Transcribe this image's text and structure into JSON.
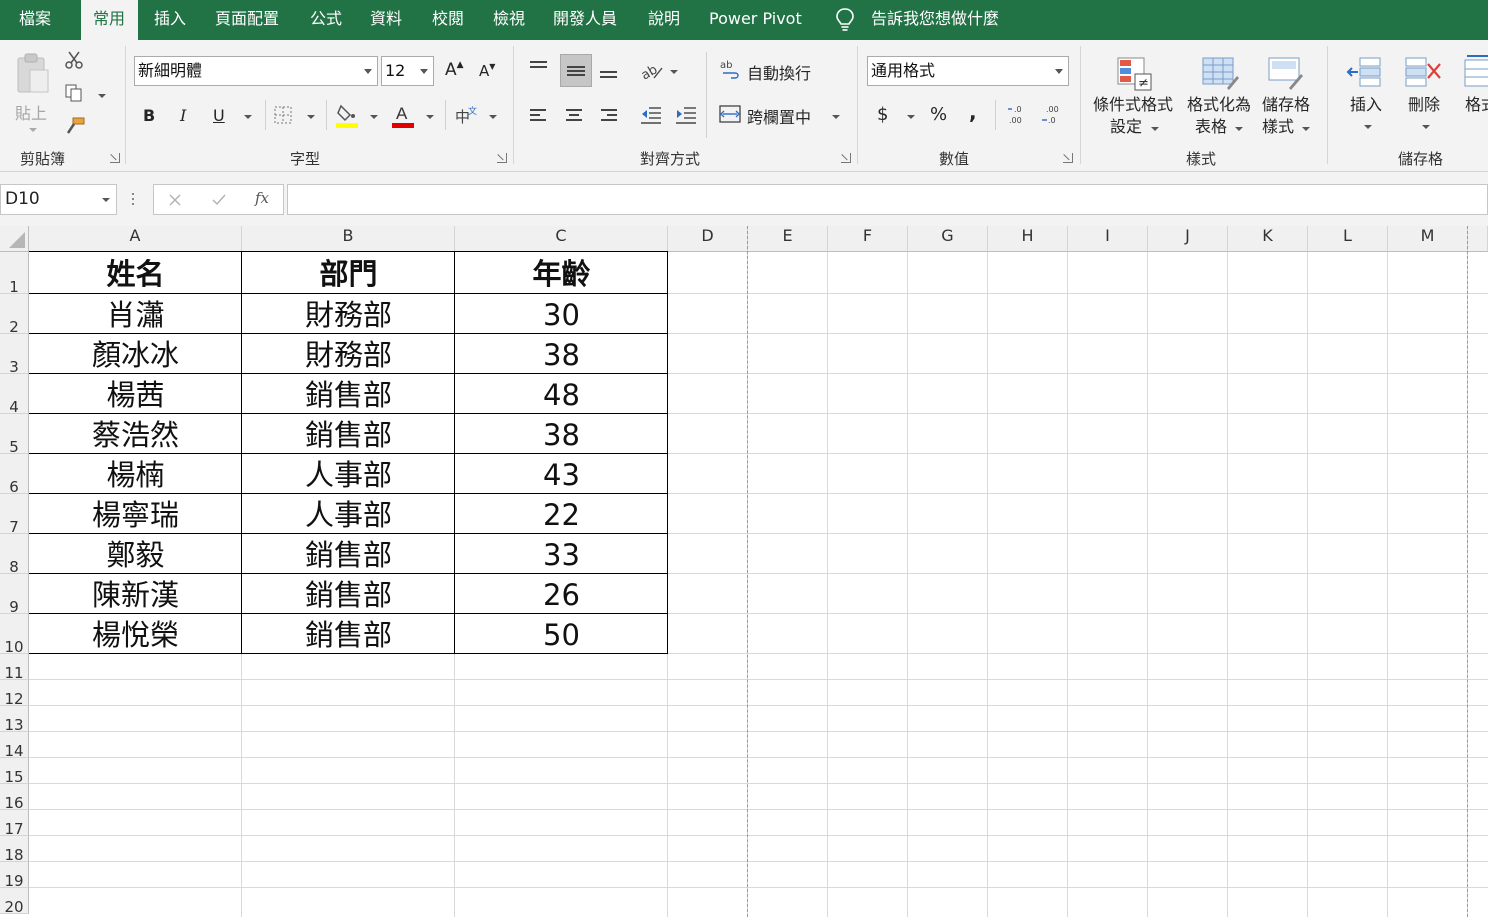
{
  "tabs": [
    {
      "label": "檔案",
      "active": false
    },
    {
      "label": "常用",
      "active": true
    },
    {
      "label": "插入",
      "active": false
    },
    {
      "label": "頁面配置",
      "active": false
    },
    {
      "label": "公式",
      "active": false
    },
    {
      "label": "資料",
      "active": false
    },
    {
      "label": "校閱",
      "active": false
    },
    {
      "label": "檢視",
      "active": false
    },
    {
      "label": "開發人員",
      "active": false
    },
    {
      "label": "說明",
      "active": false
    },
    {
      "label": "Power Pivot",
      "active": false
    }
  ],
  "tell_me": "告訴我您想做什麼",
  "ribbon": {
    "clipboard": {
      "paste_label": "貼上",
      "group_label": "剪貼簿"
    },
    "font": {
      "font_name": "新細明體",
      "font_size": "12",
      "group_label": "字型",
      "bold": "B",
      "italic": "I",
      "underline": "U",
      "font_color": "#e00000",
      "fill_color": "#ffff00"
    },
    "alignment": {
      "wrap_text": "自動換行",
      "merge_center": "跨欄置中",
      "group_label": "對齊方式"
    },
    "number": {
      "format": "通用格式",
      "currency": "$",
      "percent": "%",
      "comma": ",",
      "group_label": "數值"
    },
    "styles": {
      "conditional_1": "條件式格式",
      "conditional_2": "設定",
      "format_table_1": "格式化為",
      "format_table_2": "表格",
      "cell_styles_1": "儲存格",
      "cell_styles_2": "樣式",
      "group_label": "樣式"
    },
    "cells": {
      "insert": "插入",
      "delete": "刪除",
      "format": "格式",
      "group_label": "儲存格"
    }
  },
  "formula_bar": {
    "name_box": "D10",
    "fx": "fx",
    "formula": ""
  },
  "columns": [
    "A",
    "B",
    "C",
    "D",
    "E",
    "F",
    "G",
    "H",
    "I",
    "J",
    "K",
    "L",
    "M"
  ],
  "rows": [
    "1",
    "2",
    "3",
    "4",
    "5",
    "6",
    "7",
    "8",
    "9",
    "10",
    "11",
    "12",
    "13",
    "14",
    "15",
    "16",
    "17",
    "18",
    "19",
    "20"
  ],
  "table": {
    "header": [
      "姓名",
      "部門",
      "年齡"
    ],
    "rows": [
      [
        "肖瀟",
        "財務部",
        "30"
      ],
      [
        "顏冰冰",
        "財務部",
        "38"
      ],
      [
        "楊茜",
        "銷售部",
        "48"
      ],
      [
        "蔡浩然",
        "銷售部",
        "38"
      ],
      [
        "楊楠",
        "人事部",
        "43"
      ],
      [
        "楊寧瑞",
        "人事部",
        "22"
      ],
      [
        "鄭毅",
        "銷售部",
        "33"
      ],
      [
        "陳新漢",
        "銷售部",
        "26"
      ],
      [
        "楊悅榮",
        "銷售部",
        "50"
      ]
    ]
  },
  "colors": {
    "accent": "#217346",
    "ribbon_bg": "#f3f3f3",
    "gridline": "#d9d9d9"
  }
}
